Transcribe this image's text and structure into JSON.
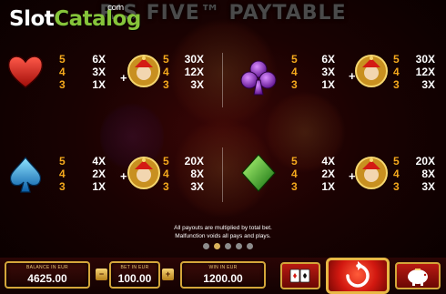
{
  "title": "R'S FIVE™ PAYTABLE",
  "watermark": {
    "part1": "Slot",
    "part2": "Catalog",
    "suffix": "com"
  },
  "paytable": {
    "counts": [
      "5",
      "4",
      "3"
    ],
    "groups": [
      {
        "symbol": "heart-icon",
        "color": "#e0201a",
        "pays": [
          "6X",
          "3X",
          "1X"
        ],
        "jester_pays": [
          "30X",
          "12X",
          "3X"
        ]
      },
      {
        "symbol": "club-icon",
        "color": "#9b2fd0",
        "pays": [
          "6X",
          "3X",
          "1X"
        ],
        "jester_pays": [
          "30X",
          "12X",
          "3X"
        ]
      },
      {
        "symbol": "spade-icon",
        "color": "#1ea6e8",
        "pays": [
          "4X",
          "2X",
          "1X"
        ],
        "jester_pays": [
          "20X",
          "8X",
          "3X"
        ]
      },
      {
        "symbol": "diamond-icon",
        "color": "#2fbf2a",
        "pays": [
          "4X",
          "2X",
          "1X"
        ],
        "jester_pays": [
          "20X",
          "8X",
          "3X"
        ]
      }
    ],
    "plus": "+"
  },
  "footer": {
    "line1": "All payouts are multiplied by total bet.",
    "line2": "Malfunction voids all pays and plays.",
    "pages": 5,
    "active_page": 1
  },
  "controls": {
    "balance_label": "BALANCE IN EUR",
    "balance_value": "4625.00",
    "bet_label": "BET IN EUR",
    "bet_value": "100.00",
    "win_label": "WIN IN EUR",
    "win_value": "1200.00",
    "minus": "−",
    "plus": "+"
  }
}
